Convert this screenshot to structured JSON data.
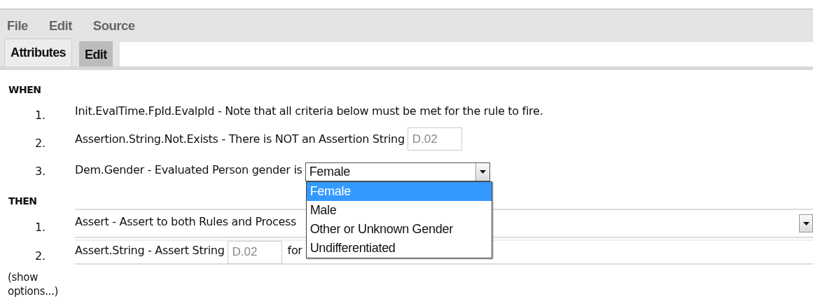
{
  "menu": [
    {
      "label": "File"
    },
    {
      "label": "Edit"
    },
    {
      "label": "Source"
    }
  ],
  "tabs": [
    {
      "label": "Attributes",
      "selected": false
    },
    {
      "label": "Edit",
      "selected": true
    }
  ],
  "sections": [
    {
      "heading": "WHEN",
      "items": [
        {
          "number": "1.",
          "kind": "text",
          "text": "Init.EvalTime.FpId.EvalpId - Note that all criteria below must be met for the rule to fire."
        },
        {
          "number": "2.",
          "kind": "field",
          "text": "Assertion.String.Not.Exists - There is NOT an Assertion String",
          "placeholder": "D.02"
        },
        {
          "number": "3.",
          "kind": "select",
          "text": "Dem.Gender - Evaluated Person gender is",
          "value": "Female",
          "expanded": true,
          "options": [
            {
              "label": "Female",
              "selected": true
            },
            {
              "label": "Male",
              "selected": false
            },
            {
              "label": "Other or Unknown Gender",
              "selected": false
            },
            {
              "label": "Undifferentiated",
              "selected": false
            }
          ]
        }
      ]
    },
    {
      "heading": "THEN",
      "items": [
        {
          "number": "1.",
          "kind": "select_row",
          "text": "Assert - Assert to both Rules and Process"
        },
        {
          "number": "2.",
          "kind": "field_row",
          "text": "Assert.String - Assert String",
          "placeholder": "D.02",
          "suffix": "for"
        }
      ]
    }
  ],
  "show_options": "(show options...)"
}
